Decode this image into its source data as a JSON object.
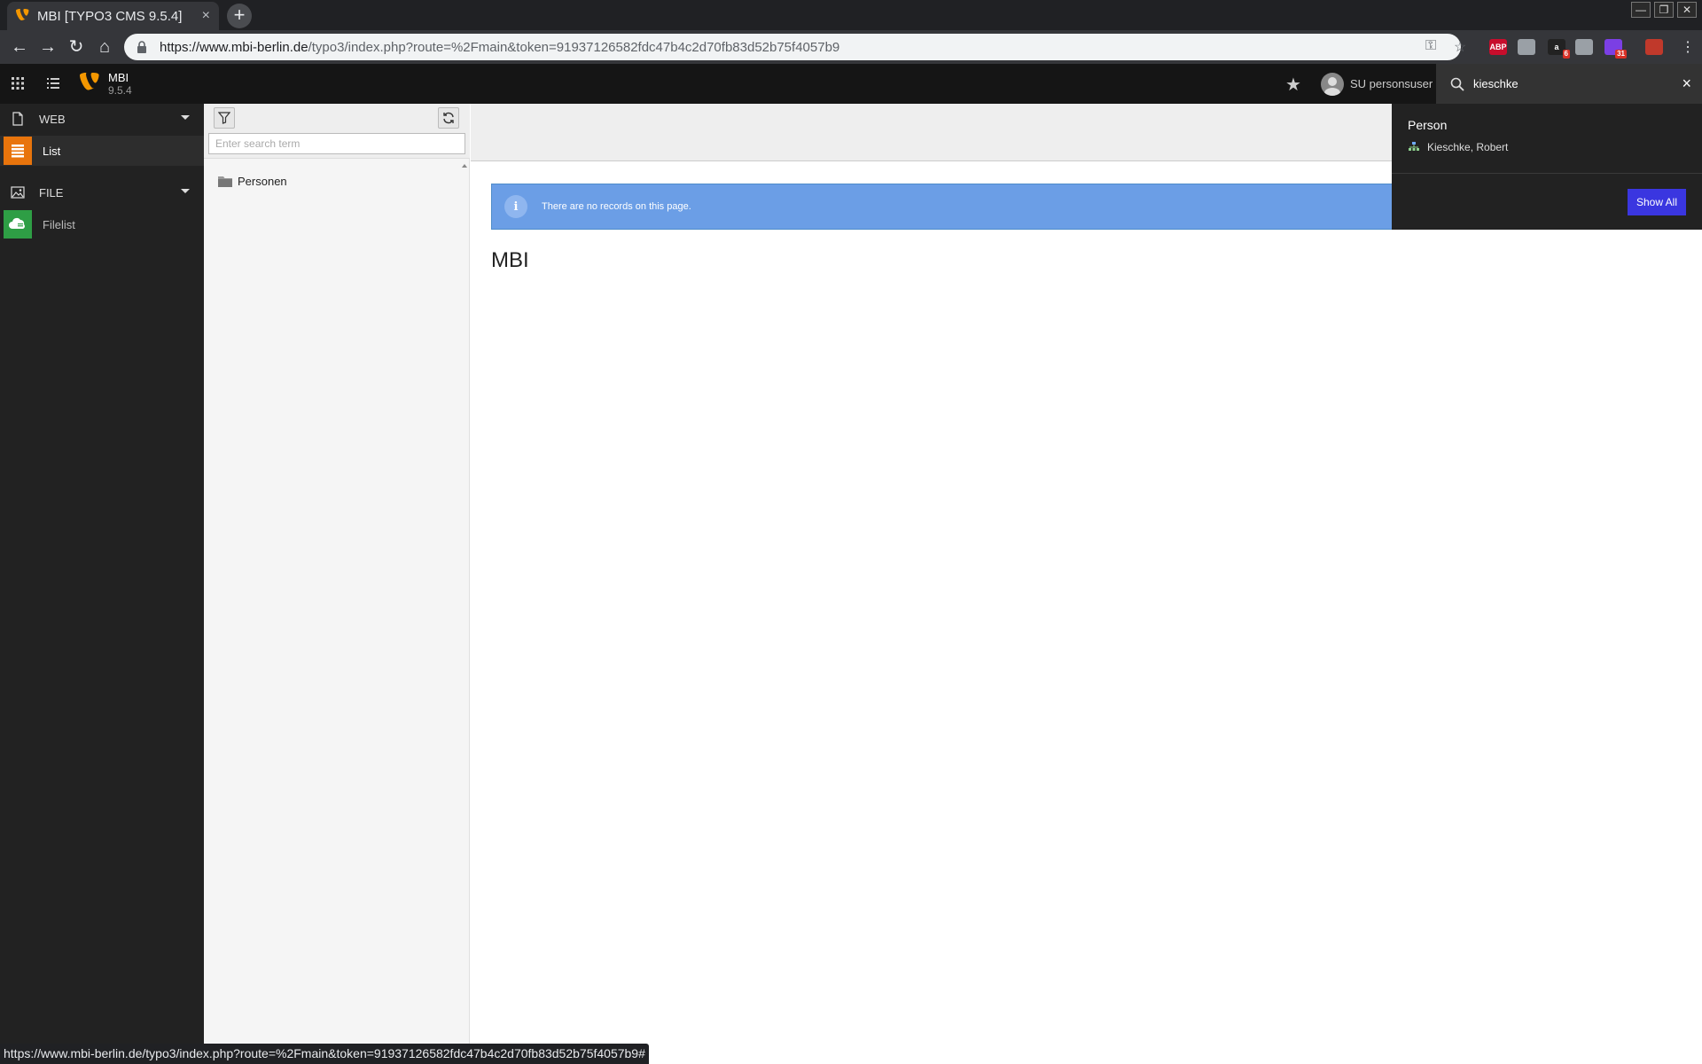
{
  "browser": {
    "tab_title": "MBI [TYPO3 CMS 9.5.4]",
    "tab_close": "×",
    "new_tab": "+",
    "url_host": "https://www.mbi-berlin.de",
    "url_path": "/typo3/index.php?route=%2Fmain&token=91937126582fdc47b4c2d70fb83d52b75f4057b9",
    "status_url": "https://www.mbi-berlin.de/typo3/index.php?route=%2Fmain&token=91937126582fdc47b4c2d70fb83d52b75f4057b9#",
    "extensions": [
      {
        "label": "ABP",
        "color": "#c70d2c"
      },
      {
        "label": "",
        "color": "#9aa0a6"
      },
      {
        "label": "a",
        "color": "#222222",
        "badge": "6"
      },
      {
        "label": "",
        "color": "#9aa0a6"
      },
      {
        "label": "",
        "color": "#7b3fe4",
        "badge": "31"
      },
      {
        "label": "",
        "color": "#c0392b"
      }
    ]
  },
  "typo3": {
    "site_name": "MBI",
    "version": "9.5.4",
    "username": "SU personsuser",
    "search_value": "kieschke",
    "search_clear": "×"
  },
  "module_menu": {
    "groups": [
      {
        "label": "WEB",
        "icon": "page-icon",
        "modules": [
          {
            "label": "List",
            "icon": "list-module-icon",
            "color": "#e8740c"
          }
        ]
      },
      {
        "label": "FILE",
        "icon": "image-icon",
        "modules": [
          {
            "label": "Filelist",
            "icon": "filelist-module-icon",
            "color": "#2e9e45"
          }
        ]
      }
    ]
  },
  "page_tree": {
    "search_placeholder": "Enter search term",
    "root_node": "Personen"
  },
  "content": {
    "info_message": "There are no records on this page.",
    "page_title": "MBI",
    "info_icon": "i"
  },
  "search_results": {
    "type_heading": "Person",
    "items": [
      {
        "label": "Kieschke, Robert"
      }
    ],
    "show_all_label": "Show All"
  }
}
